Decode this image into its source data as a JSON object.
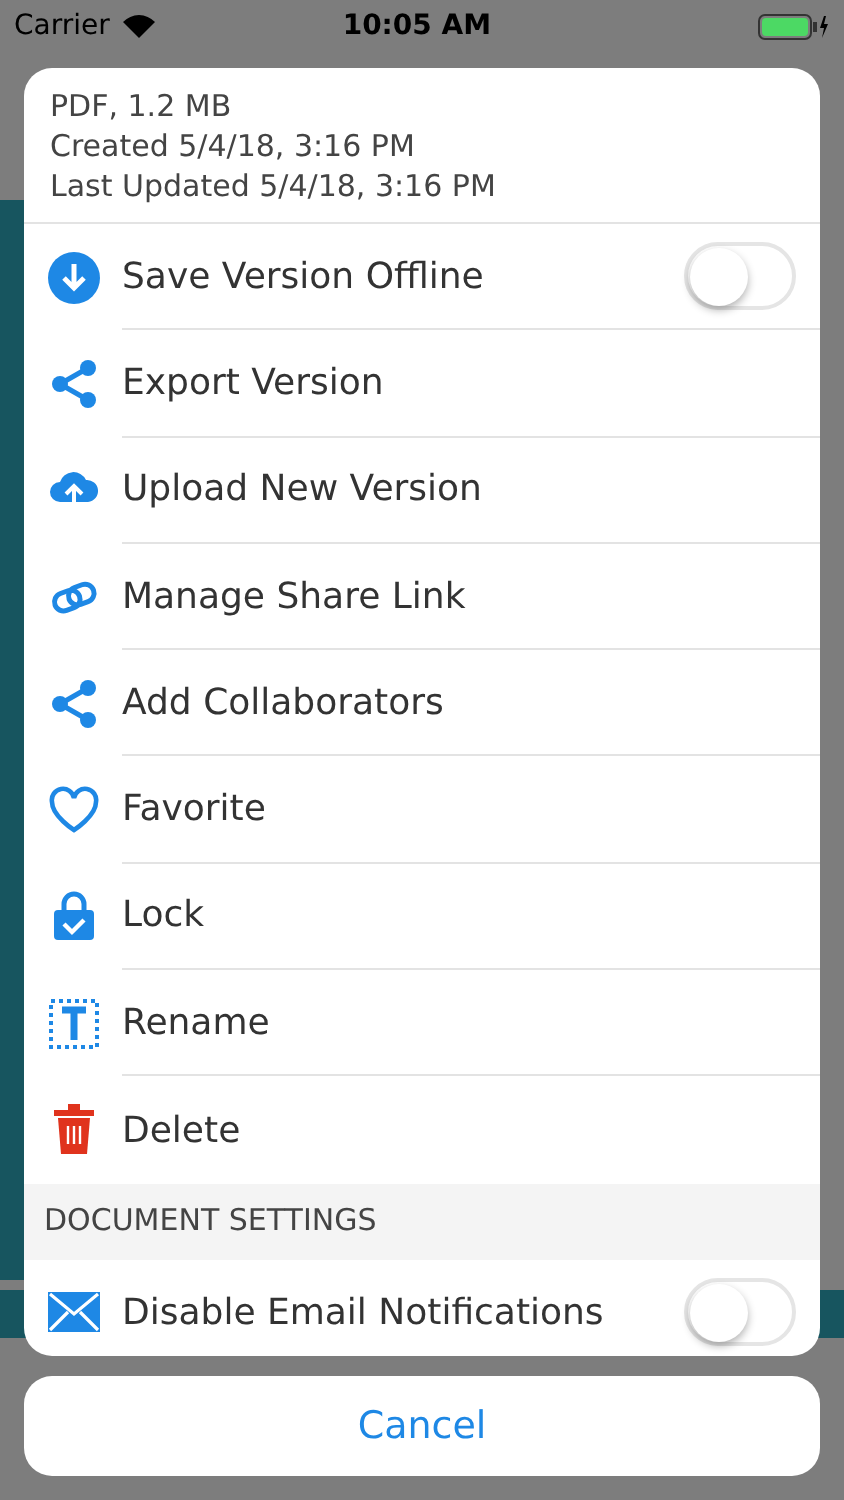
{
  "status_bar": {
    "carrier": "Carrier",
    "time": "10:05 AM"
  },
  "info": [
    "PDF, 1.2 MB",
    "Created 5/4/18, 3:16 PM",
    "Last Updated 5/4/18, 3:16 PM"
  ],
  "actions": [
    {
      "label": "Save Version Offline",
      "kind": "toggle",
      "on": false
    },
    {
      "label": "Export Version",
      "kind": "action"
    },
    {
      "label": "Upload New Version",
      "kind": "action"
    },
    {
      "label": "Manage Share Link",
      "kind": "action"
    },
    {
      "label": "Add Collaborators",
      "kind": "action"
    },
    {
      "label": "Favorite",
      "kind": "action"
    },
    {
      "label": "Lock",
      "kind": "action"
    },
    {
      "label": "Rename",
      "kind": "action"
    },
    {
      "label": "Delete",
      "kind": "action"
    }
  ],
  "section": {
    "title": "DOCUMENT SETTINGS",
    "items": [
      {
        "label": "Disable Email Notifications",
        "kind": "toggle",
        "on": false
      }
    ]
  },
  "cancel": "Cancel"
}
